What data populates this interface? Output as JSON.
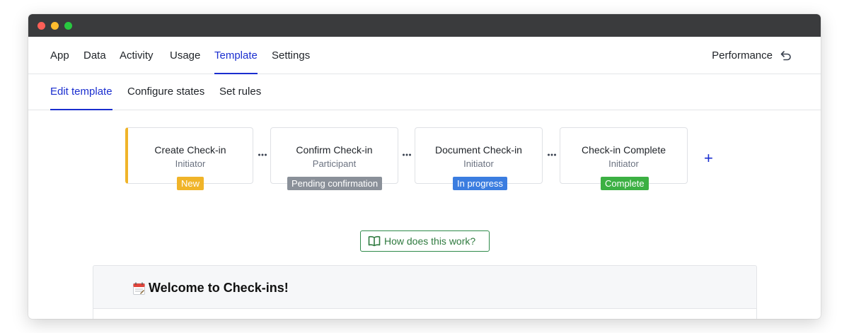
{
  "window": {
    "controls": [
      "close",
      "minimize",
      "maximize"
    ]
  },
  "topnav": {
    "tabs": [
      {
        "label": "App"
      },
      {
        "label": "Data"
      },
      {
        "label": "Activity"
      },
      {
        "label": "Usage"
      },
      {
        "label": "Template",
        "active": true
      },
      {
        "label": "Settings"
      }
    ],
    "performance_label": "Performance",
    "performance_icon": "undo-arrow-icon"
  },
  "subnav": {
    "tabs": [
      {
        "label": "Edit template",
        "active": true
      },
      {
        "label": "Configure states"
      },
      {
        "label": "Set rules"
      }
    ]
  },
  "states": [
    {
      "title": "Create Check-in",
      "role": "Initiator",
      "badge": "New",
      "badge_color": "#f0b429"
    },
    {
      "title": "Confirm Check-in",
      "role": "Participant",
      "badge": "Pending confirmation",
      "badge_color": "#8a9099"
    },
    {
      "title": "Document Check-in",
      "role": "Initiator",
      "badge": "In progress",
      "badge_color": "#3b7de0"
    },
    {
      "title": "Check-in Complete",
      "role": "Initiator",
      "badge": "Complete",
      "badge_color": "#3cb043"
    }
  ],
  "add_state_icon": "plus-icon",
  "help_button": {
    "label": "How does this work?",
    "icon": "book-open-icon"
  },
  "welcome": {
    "heading": "Welcome to Check-ins!",
    "icon": "calendar-icon"
  },
  "colors": {
    "accent": "#1a2ecf",
    "help_green": "#2f8a4a",
    "first_state_border": "#f0b429"
  }
}
